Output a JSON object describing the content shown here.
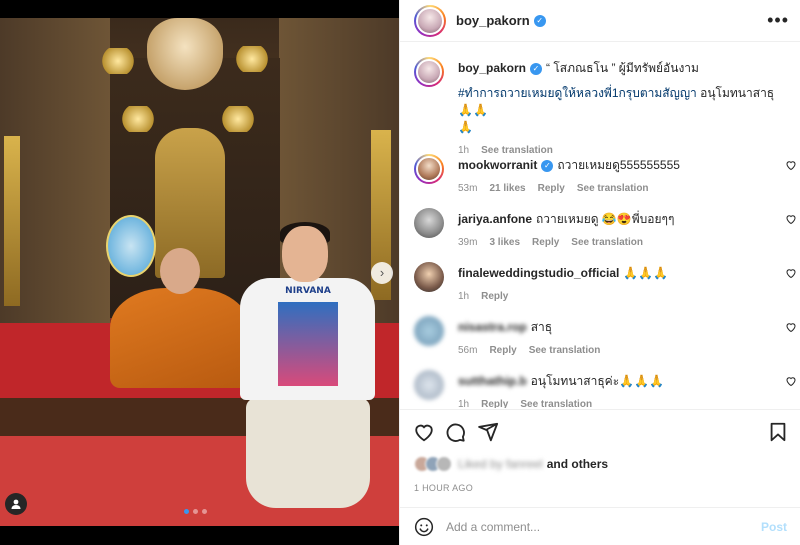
{
  "post": {
    "username": "boy_pakorn",
    "more_label": "•••"
  },
  "caption": {
    "username": "boy_pakorn",
    "text": "“ โสภณธโน ” ผู้มีทรัพย์อันงาม",
    "hashtag": "#ทำการถวายเหมยดูให้หลวงพี่1กรุบตามสัญญา",
    "text2": " อนุโมทนาสาธุ🙏🙏",
    "text3": "🙏",
    "time": "1h",
    "see_translation": "See translation"
  },
  "comments": [
    {
      "username": "mookworranit",
      "verified": true,
      "text": "ถวายเหมยดู555555555",
      "time": "53m",
      "likes": "21 likes",
      "reply": "Reply",
      "see_translation": "See translation"
    },
    {
      "username": "jariya.anfone",
      "verified": false,
      "text": "ถวายเหมยดู 😂😍พี่บอยๆๆ",
      "time": "39m",
      "likes": "3 likes",
      "reply": "Reply",
      "see_translation": "See translation"
    },
    {
      "username": "finaleweddingstudio_official",
      "verified": false,
      "text": "🙏🙏🙏",
      "time": "1h",
      "reply": "Reply"
    },
    {
      "username": "nisastra.rop",
      "verified": false,
      "text": "สาธุ",
      "time": "56m",
      "reply": "Reply",
      "see_translation": "See translation"
    },
    {
      "username": "sutthathip.b",
      "verified": false,
      "text": "อนุโมทนาสาธุค่ะ🙏🙏🙏",
      "time": "1h",
      "reply": "Reply",
      "see_translation": "See translation"
    }
  ],
  "likes": {
    "liked_by": "Liked by fanreel",
    "and_others": "and others"
  },
  "timestamp": "1 HOUR AGO",
  "add_comment": {
    "placeholder": "Add a comment...",
    "post_label": "Post"
  },
  "photo": {
    "shirt_text": "NIRVANA",
    "carousel_count": 3,
    "active_index": 0
  },
  "colors": {
    "verified_blue": "#3897f0",
    "link_dark": "#00376b",
    "post_disabled": "#b2dffc",
    "secondary_text": "#8e8e8e"
  }
}
